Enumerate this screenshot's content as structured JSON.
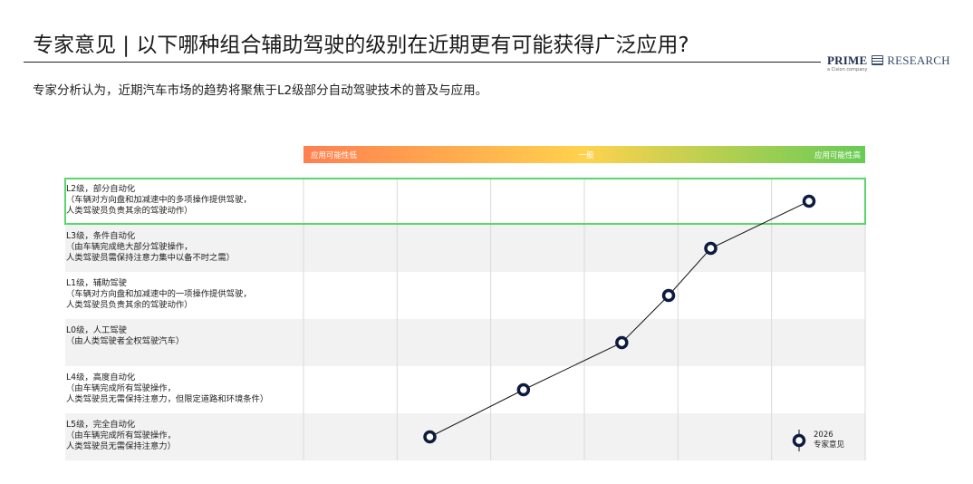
{
  "header": {
    "title": "专家意见 | 以下哪种组合辅助驾驶的级别在近期更有可能获得广泛应用?",
    "subtitle": "专家分析认为，近期汽车市场的趋势将聚焦于L2级部分自动驾驶技术的普及与应用。"
  },
  "logo": {
    "brand_bold": "PRIME",
    "brand_rest": "RESEARCH",
    "tagline": "a Cision company"
  },
  "gradient_bar": {
    "low_label": "应用可能性低",
    "mid_label": "一般",
    "high_label": "应用可能性高",
    "colors": [
      "#ff7f50",
      "#ffd24d",
      "#66cc55"
    ]
  },
  "legend": {
    "year": "2026",
    "label": "专家意见"
  },
  "chart_data": {
    "type": "line",
    "x_scale": "ordinal, 6 steps from 应用可能性低 to 应用可能性高",
    "xlim": [
      0,
      6
    ],
    "categories": [
      {
        "lines": [
          "L2级，部分自动化",
          "（车辆对方向盘和加减速中的多项操作提供驾驶，",
          "人类驾驶员负责其余的驾驶动作）"
        ]
      },
      {
        "lines": [
          "L3级，条件自动化",
          "（由车辆完成绝大部分驾驶操作，",
          "人类驾驶员需保持注意力集中以备不时之需）"
        ]
      },
      {
        "lines": [
          "L1级，辅助驾驶",
          "（车辆对方向盘和加减速中的一项操作提供驾驶，",
          "人类驾驶员负责其余的驾驶动作）"
        ]
      },
      {
        "lines": [
          "L0级，人工驾驶",
          "（由人类驾驶者全权驾驶汽车）"
        ]
      },
      {
        "lines": [
          "L4级，高度自动化",
          "（由车辆完成所有驾驶操作，",
          "人类驾驶员无需保持注意力，但限定道路和环境条件）"
        ]
      },
      {
        "lines": [
          "L5级，完全自动化",
          "（由车辆完成所有驾驶操作，",
          "人类驾驶员无需保持注意力）"
        ]
      }
    ],
    "series": [
      {
        "name": "2026 专家意见",
        "color": "#0d1b3e",
        "values": [
          5.4,
          4.35,
          3.9,
          3.4,
          2.35,
          1.35
        ]
      }
    ],
    "highlight_row": 0,
    "highlight_color": "#5bd56e",
    "row_fill_alternate": [
      "#ffffff",
      "#f2f2f2"
    ]
  }
}
